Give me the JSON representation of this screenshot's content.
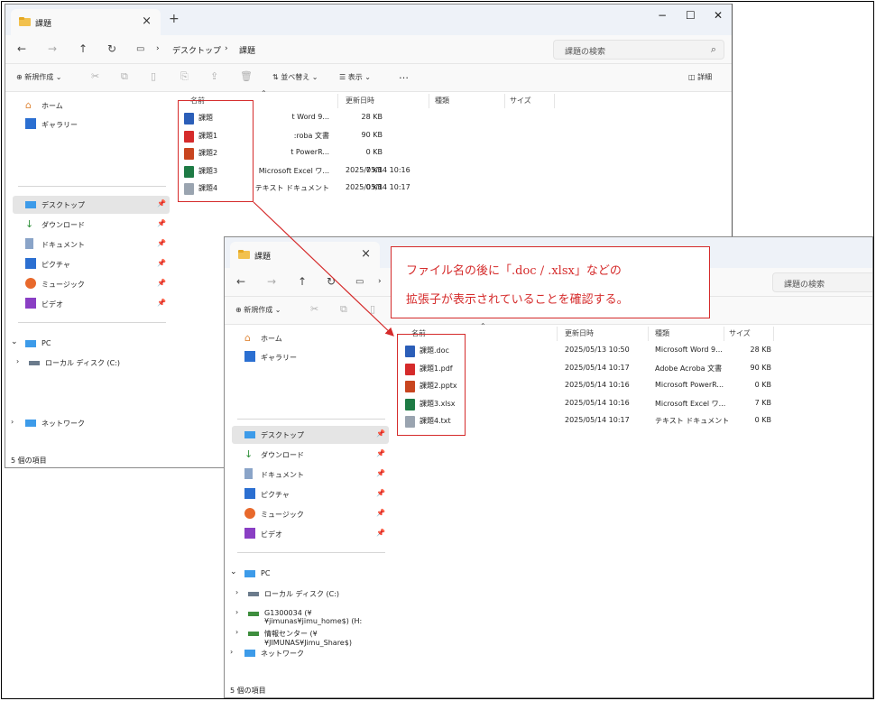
{
  "back": {
    "tab_title": "課題",
    "breadcrumb": [
      "デスクトップ",
      "課題"
    ],
    "search_placeholder": "課題の検索",
    "toolbar": {
      "new": "新規作成",
      "sort": "並べ替え",
      "view": "表示",
      "more": "…",
      "details": "詳細"
    },
    "sidebar": {
      "home": "ホーム",
      "gallery": "ギャラリー",
      "pinned": [
        "デスクトップ",
        "ダウンロード",
        "ドキュメント",
        "ピクチャ",
        "ミュージック",
        "ビデオ"
      ],
      "pc": "PC",
      "local_disk": "ローカル ディスク (C:)",
      "network": "ネットワーク"
    },
    "columns": {
      "name": "名前",
      "date": "更新日時",
      "type": "種類",
      "size": "サイズ"
    },
    "files": [
      {
        "name": "課題",
        "date": "",
        "type": "t Word 9...",
        "size": "28 KB",
        "icon": "word-icon"
      },
      {
        "name": "課題1",
        "date": "",
        "type": ":roba 文書",
        "size": "90 KB",
        "icon": "pdf-icon"
      },
      {
        "name": "課題2",
        "date": "",
        "type": "t PowerR...",
        "size": "0 KB",
        "icon": "powerpoint-icon"
      },
      {
        "name": "課題3",
        "date": "2025/05/14 10:16",
        "type": "Microsoft Excel ワ...",
        "size": "7 KB",
        "icon": "excel-icon"
      },
      {
        "name": "課題4",
        "date": "2025/05/14 10:17",
        "type": "テキスト ドキュメント",
        "size": "0 KB",
        "icon": "text-icon"
      }
    ],
    "status": "5 個の項目"
  },
  "front": {
    "tab_title": "課題",
    "search_placeholder": "課題の検索",
    "toolbar": {
      "new": "新規作成"
    },
    "sidebar": {
      "home": "ホーム",
      "gallery": "ギャラリー",
      "pinned": [
        "デスクトップ",
        "ダウンロード",
        "ドキュメント",
        "ピクチャ",
        "ミュージック",
        "ビデオ"
      ],
      "pc": "PC",
      "local_disk": "ローカル ディスク (C:)",
      "drive_home": "G1300034 (¥¥jimunas¥jimu_home$) (H:",
      "drive_share": "情報センター (¥¥JIMUNAS¥Jimu_Share$)",
      "network": "ネットワーク"
    },
    "columns": {
      "name": "名前",
      "date": "更新日時",
      "type": "種類",
      "size": "サイズ"
    },
    "files": [
      {
        "name": "課題.doc",
        "date": "2025/05/13 10:50",
        "type": "Microsoft Word 9...",
        "size": "28 KB",
        "icon": "word-icon"
      },
      {
        "name": "課題1.pdf",
        "date": "2025/05/14 10:17",
        "type": "Adobe Acroba 文書",
        "size": "90 KB",
        "icon": "pdf-icon"
      },
      {
        "name": "課題2.pptx",
        "date": "2025/05/14 10:16",
        "type": "Microsoft PowerR...",
        "size": "0 KB",
        "icon": "powerpoint-icon"
      },
      {
        "name": "課題3.xlsx",
        "date": "2025/05/14 10:16",
        "type": "Microsoft Excel ワ...",
        "size": "7 KB",
        "icon": "excel-icon"
      },
      {
        "name": "課題4.txt",
        "date": "2025/05/14 10:17",
        "type": "テキスト ドキュメント",
        "size": "0 KB",
        "icon": "text-icon"
      }
    ],
    "status": "5 個の項目"
  },
  "callout": {
    "line1": "ファイル名の後に「.doc / .xlsx」などの",
    "line2": "拡張子が表示されていることを確認する。"
  },
  "colors": {
    "accent_red": "#d52b2b",
    "titlebar": "#eef2f8",
    "selection": "#e5e5e5"
  }
}
